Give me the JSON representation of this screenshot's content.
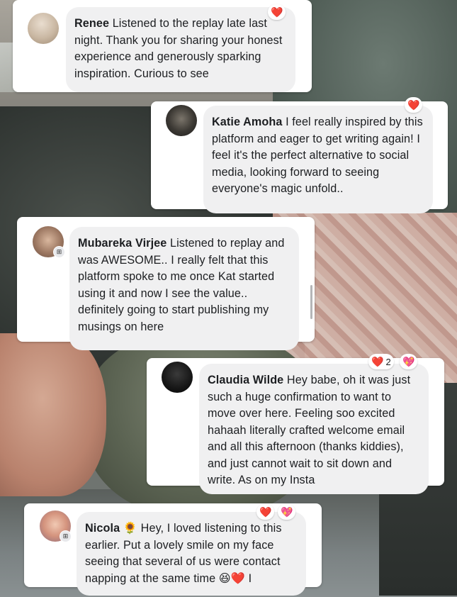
{
  "comments": [
    {
      "author": "Renee",
      "text": "Listened to the replay late last night. Thank you for sharing your honest experience and generously sparking inspiration. Curious to see",
      "reactions": [
        {
          "icon": "red-heart-icon",
          "glyph": "❤️"
        }
      ]
    },
    {
      "author": "Katie Amoha",
      "text": "I feel really inspired by this platform and eager to get writing again! I feel it's the perfect alternative to social media, looking forward to seeing everyone's magic unfold..",
      "reactions": [
        {
          "icon": "red-heart-icon",
          "glyph": "❤️"
        }
      ]
    },
    {
      "author": "Mubareka Virjee",
      "text": "Listened to replay and was AWESOME.. I really felt that this platform spoke to me once Kat started using it and now I see the value.. definitely going to start publishing my musings on here",
      "reactions": []
    },
    {
      "author": "Claudia Wilde",
      "text": "Hey babe, oh it was just such a huge confirmation to want to move over here. Feeling soo excited hahaah literally crafted welcome email and all this afternoon (thanks kiddies), and just cannot wait to sit down and write. As on my Insta",
      "reactions": [
        {
          "icon": "red-heart-icon",
          "glyph": "❤️",
          "count": "2"
        },
        {
          "icon": "sparkling-heart-icon",
          "glyph": "💖"
        }
      ]
    },
    {
      "author": "Nicola",
      "author_emoji": "🌻",
      "text": "Hey, I loved listening to this earlier. Put a lovely smile on my face seeing that several of us were contact napping at the same time 😆❤️ I",
      "reactions": [
        {
          "icon": "red-heart-icon",
          "glyph": "❤️"
        },
        {
          "icon": "sparkling-heart-icon",
          "glyph": "💖"
        }
      ]
    }
  ],
  "colors": {
    "card_bg": "#ffffff",
    "bubble_bg": "#f0f0f1",
    "text": "#1c1e21"
  },
  "icons": {
    "badge": "community-badge-icon"
  }
}
